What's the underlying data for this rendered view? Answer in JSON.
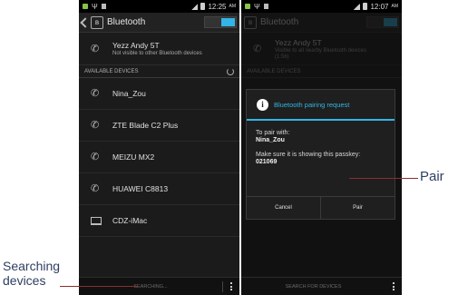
{
  "left_screen": {
    "status_time": "12:25",
    "status_ampm": "AM",
    "title": "Bluetooth",
    "my_device": {
      "name": "Yezz Andy 5T",
      "status": "Not visible to other Bluetooth devices"
    },
    "section_header": "AVAILABLE DEVICES",
    "devices": [
      {
        "name": "Nina_Zou",
        "icon": "phone-icon"
      },
      {
        "name": "ZTE Blade C2 Plus",
        "icon": "phone-icon"
      },
      {
        "name": "MEIZU MX2",
        "icon": "phone-icon"
      },
      {
        "name": "HUAWEI C8813",
        "icon": "phone-icon"
      },
      {
        "name": "CDZ-iMac",
        "icon": "laptop-icon"
      }
    ],
    "bottom_button": "SEARCHING..."
  },
  "right_screen": {
    "status_time": "12:07",
    "status_ampm": "AM",
    "title": "Bluetooth",
    "my_device": {
      "name": "Yezz Andy 5T",
      "status": "Visible to all nearby Bluetooth devices",
      "timer": "(1:56)"
    },
    "section_header": "AVAILABLE DEVICES",
    "dialog": {
      "title": "Bluetooth pairing request",
      "pair_with_label": "To pair with:",
      "pair_with_name": "Nina_Zou",
      "instruction": "Make sure it is showing this passkey:",
      "passkey": "021069",
      "cancel": "Cancel",
      "pair": "Pair"
    },
    "bottom_button": "SEARCH FOR DEVICES"
  },
  "annotations": {
    "searching_line1": "Searching",
    "searching_line2": "devices",
    "pair": "Pair"
  },
  "colors": {
    "accent": "#33b5e5",
    "callout_line": "#8b2d2d",
    "annotation_text": "#2e3e63"
  }
}
